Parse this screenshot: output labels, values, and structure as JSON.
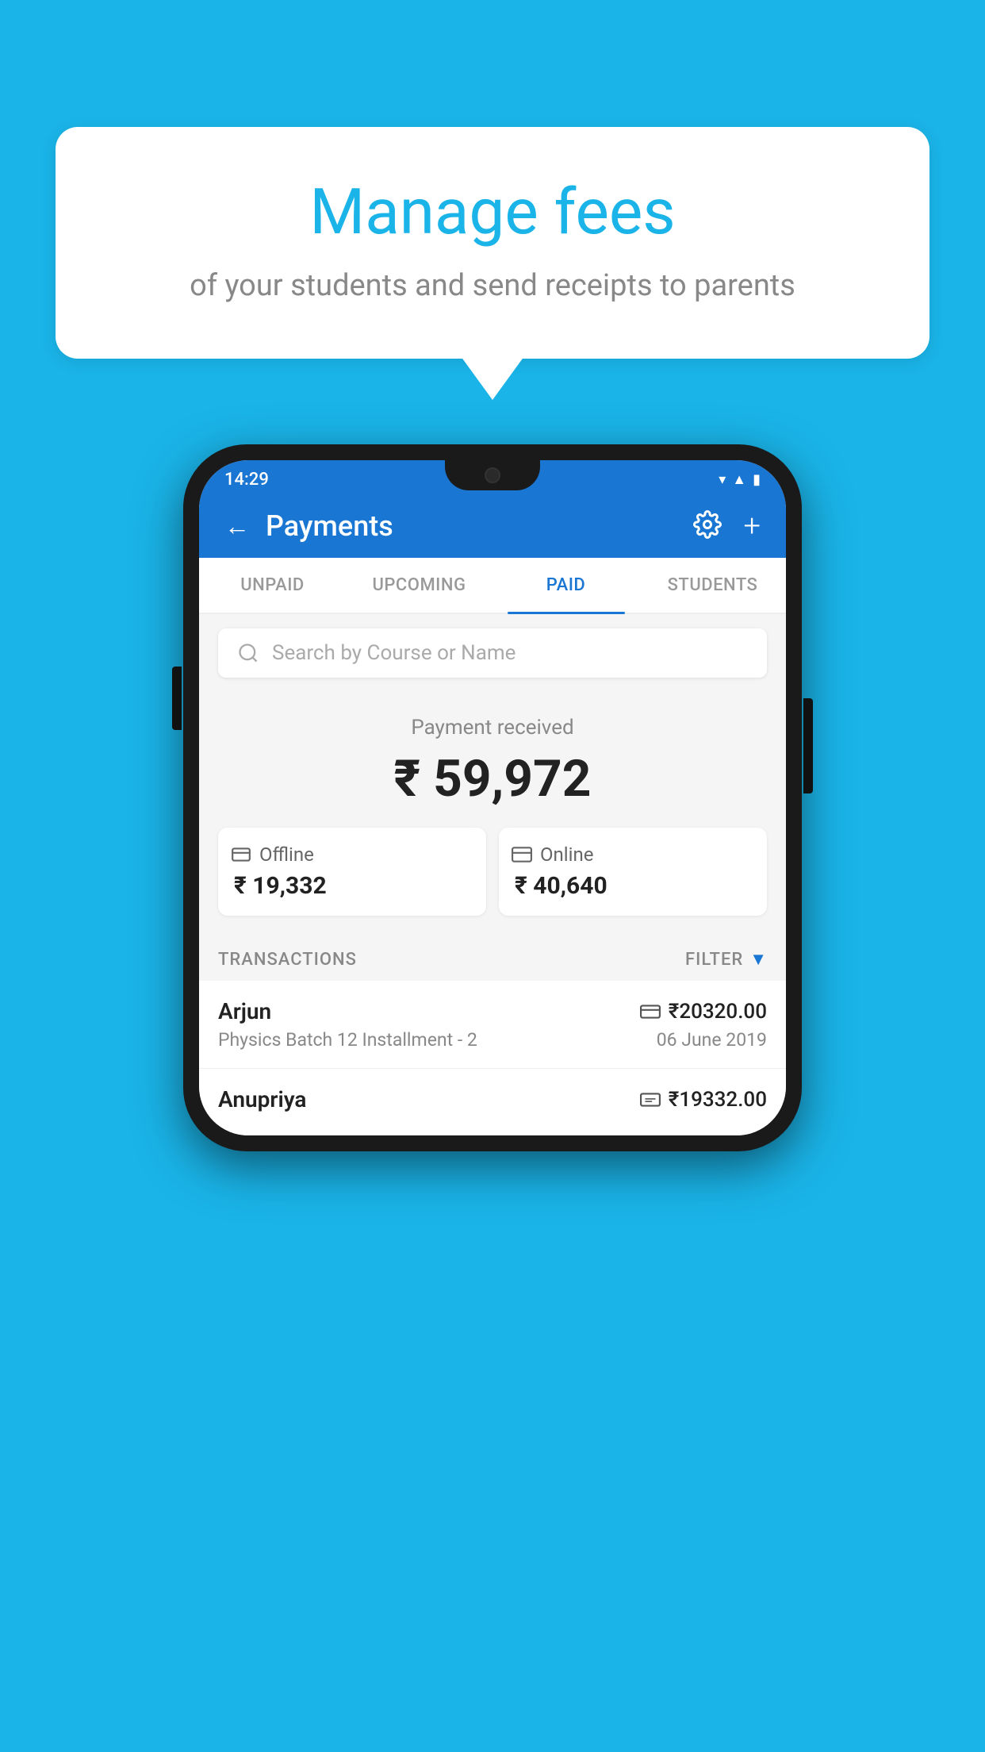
{
  "background_color": "#1ab4e8",
  "bubble": {
    "title": "Manage fees",
    "subtitle": "of your students and send receipts to parents"
  },
  "status_bar": {
    "time": "14:29",
    "icons": [
      "wifi",
      "signal",
      "battery"
    ]
  },
  "app_bar": {
    "title": "Payments",
    "back_label": "←",
    "plus_label": "+"
  },
  "tabs": [
    {
      "label": "UNPAID",
      "active": false
    },
    {
      "label": "UPCOMING",
      "active": false
    },
    {
      "label": "PAID",
      "active": true
    },
    {
      "label": "STUDENTS",
      "active": false
    }
  ],
  "search": {
    "placeholder": "Search by Course or Name"
  },
  "payment_summary": {
    "label": "Payment received",
    "amount": "₹ 59,972",
    "offline": {
      "label": "Offline",
      "amount": "₹ 19,332"
    },
    "online": {
      "label": "Online",
      "amount": "₹ 40,640"
    }
  },
  "transactions": {
    "label": "TRANSACTIONS",
    "filter_label": "FILTER",
    "rows": [
      {
        "name": "Arjun",
        "amount": "₹20320.00",
        "course": "Physics Batch 12 Installment - 2",
        "date": "06 June 2019",
        "payment_type": "card"
      },
      {
        "name": "Anupriya",
        "amount": "₹19332.00",
        "course": "",
        "date": "",
        "payment_type": "cash"
      }
    ]
  }
}
